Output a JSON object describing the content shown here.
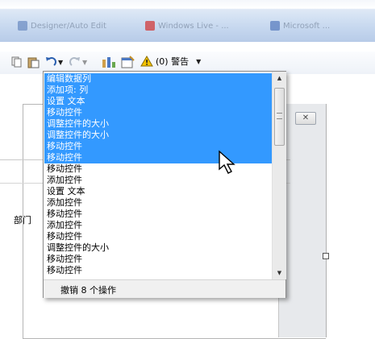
{
  "taskbar": {
    "tabs": [
      {
        "label": "Designer/Auto Edit",
        "icon_color": "#6f8fc4"
      },
      {
        "label": "Windows Live - ...",
        "icon_color": "#d23b3b"
      },
      {
        "label": "Microsoft ...",
        "icon_color": "#5b7fc0"
      }
    ]
  },
  "toolbar": {
    "icons": [
      "copy-icon",
      "paste-icon",
      "undo-icon",
      "redo-icon",
      "properties-icon",
      "form-settings-icon",
      "warning-icon"
    ],
    "warning_label": "(0) 警告"
  },
  "background": {
    "field_label": "部门",
    "close_glyph": "✕"
  },
  "dropdown": {
    "items": [
      {
        "label": "编辑数据列",
        "selected": true
      },
      {
        "label": "添加项: 列",
        "selected": true
      },
      {
        "label": "设置 文本",
        "selected": true
      },
      {
        "label": "移动控件",
        "selected": true
      },
      {
        "label": "调整控件的大小",
        "selected": true
      },
      {
        "label": "调整控件的大小",
        "selected": true
      },
      {
        "label": "移动控件",
        "selected": true
      },
      {
        "label": "移动控件",
        "selected": true
      },
      {
        "label": "移动控件",
        "selected": false
      },
      {
        "label": "添加控件",
        "selected": false
      },
      {
        "label": "设置 文本",
        "selected": false
      },
      {
        "label": "添加控件",
        "selected": false
      },
      {
        "label": "移动控件",
        "selected": false
      },
      {
        "label": "添加控件",
        "selected": false
      },
      {
        "label": "移动控件",
        "selected": false
      },
      {
        "label": "调整控件的大小",
        "selected": false
      },
      {
        "label": "移动控件",
        "selected": false
      },
      {
        "label": "移动控件",
        "selected": false
      }
    ],
    "footer_label": "撤销 8 个操作"
  },
  "colors": {
    "selection": "#3399ff",
    "warning_yellow": "#f5c400"
  }
}
